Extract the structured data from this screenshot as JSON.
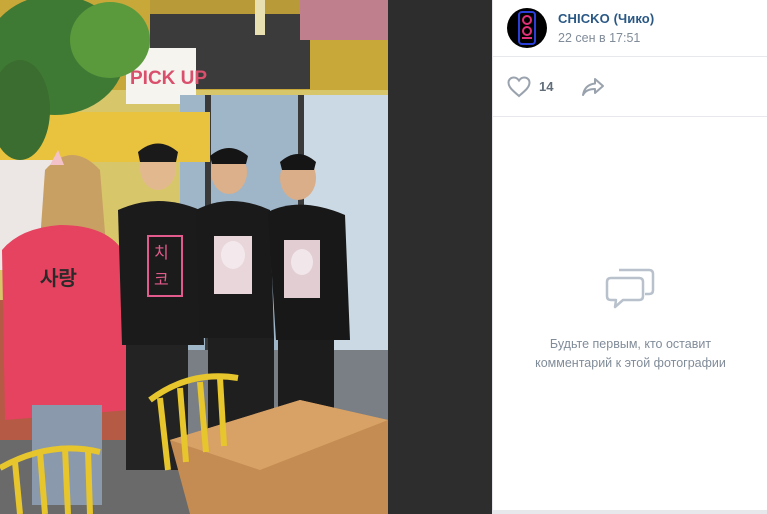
{
  "post": {
    "author": "CHICKO (Чико)",
    "date": "22 сен в 17:51",
    "likes": "14"
  },
  "photo": {
    "sign_text": "PICK UP",
    "shirt_text_left": "사랑",
    "shirt_text_center": "치\n코"
  },
  "comments": {
    "empty_text": "Будьте первым, кто оставит комментарий к этой фотографии"
  },
  "icons": {
    "like": "heart-icon",
    "share": "share-arrow-icon",
    "empty": "comments-icon"
  },
  "colors": {
    "author_link": "#2a5885",
    "meta": "#818c99",
    "icon": "#99a2ad"
  }
}
